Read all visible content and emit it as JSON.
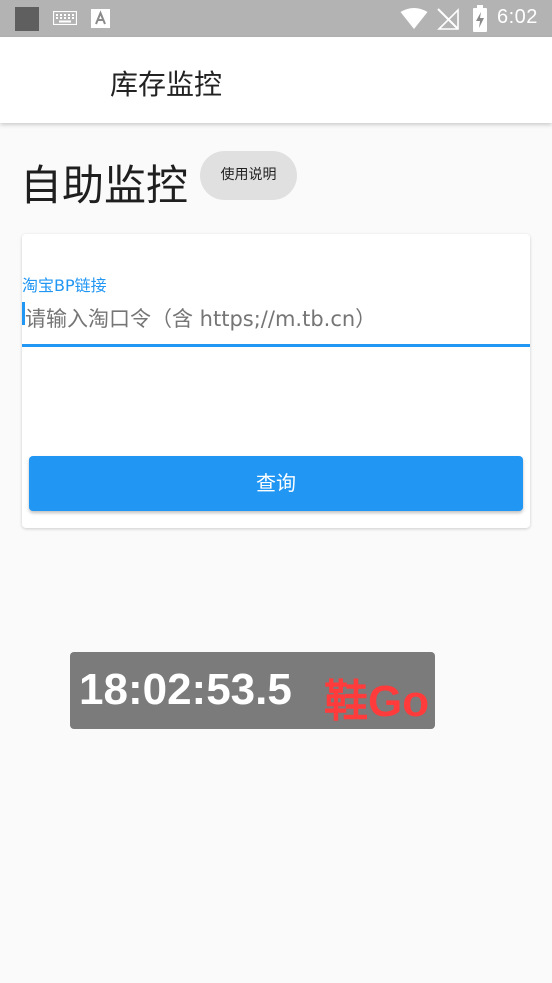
{
  "status_bar": {
    "time": "6:02",
    "icons": [
      "app-square-icon",
      "keyboard-icon",
      "font-icon",
      "wifi-icon",
      "no-signal-icon",
      "battery-charging-icon"
    ]
  },
  "app_bar": {
    "title": "库存监控"
  },
  "page": {
    "heading": "自助监控",
    "help_button": "使用说明"
  },
  "form": {
    "link_label": "淘宝BP链接",
    "link_placeholder": "请输入淘口令（含 https;//m.tb.cn）",
    "link_value": "",
    "query_button": "查询"
  },
  "overlay": {
    "time": "18:02:53.5",
    "brand": "鞋Go"
  },
  "colors": {
    "accent": "#2196f3",
    "brand_red": "#ff3b3b",
    "statusbar": "#b3b3b3",
    "overlay_bg": "#7b7b7b"
  }
}
